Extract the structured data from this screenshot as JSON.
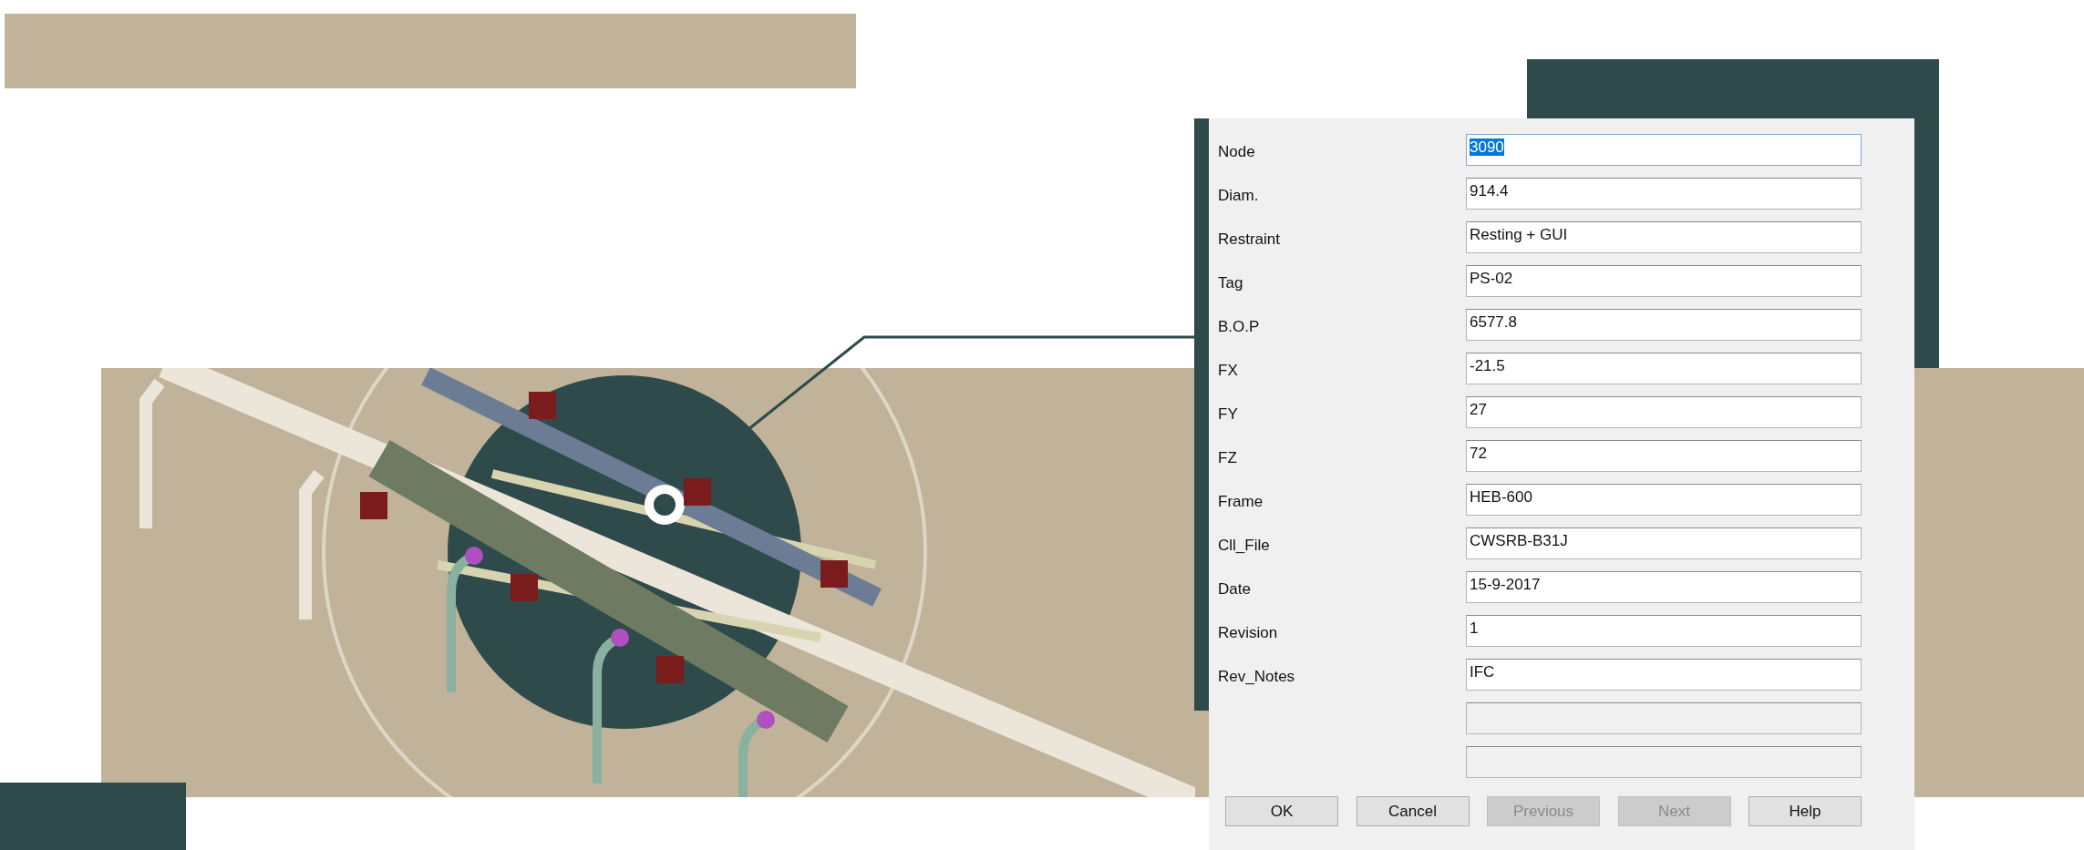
{
  "dialog": {
    "fields": [
      {
        "label": "Node",
        "value": "3090",
        "selected": true,
        "disabled": false
      },
      {
        "label": "Diam.",
        "value": "914.4",
        "selected": false,
        "disabled": false
      },
      {
        "label": "Restraint",
        "value": "Resting + GUI",
        "selected": false,
        "disabled": false
      },
      {
        "label": "Tag",
        "value": "PS-02",
        "selected": false,
        "disabled": false
      },
      {
        "label": "B.O.P",
        "value": "6577.8",
        "selected": false,
        "disabled": false
      },
      {
        "label": "FX",
        "value": "-21.5",
        "selected": false,
        "disabled": false
      },
      {
        "label": "FY",
        "value": "27",
        "selected": false,
        "disabled": false
      },
      {
        "label": "FZ",
        "value": "72",
        "selected": false,
        "disabled": false
      },
      {
        "label": "Frame",
        "value": "HEB-600",
        "selected": false,
        "disabled": false
      },
      {
        "label": "Cll_File",
        "value": "CWSRB-B31J",
        "selected": false,
        "disabled": false
      },
      {
        "label": "Date",
        "value": "15-9-2017",
        "selected": false,
        "disabled": false
      },
      {
        "label": "Revision",
        "value": "1",
        "selected": false,
        "disabled": false
      },
      {
        "label": "Rev_Notes",
        "value": "IFC",
        "selected": false,
        "disabled": false
      },
      {
        "selected": false,
        "disabled": true
      },
      {
        "selected": false,
        "disabled": true
      }
    ],
    "buttons": [
      {
        "label": "OK",
        "disabled": false
      },
      {
        "label": "Cancel",
        "disabled": false
      },
      {
        "label": "Previous",
        "disabled": true
      },
      {
        "label": "Next",
        "disabled": true
      },
      {
        "label": "Help",
        "disabled": false
      }
    ]
  }
}
